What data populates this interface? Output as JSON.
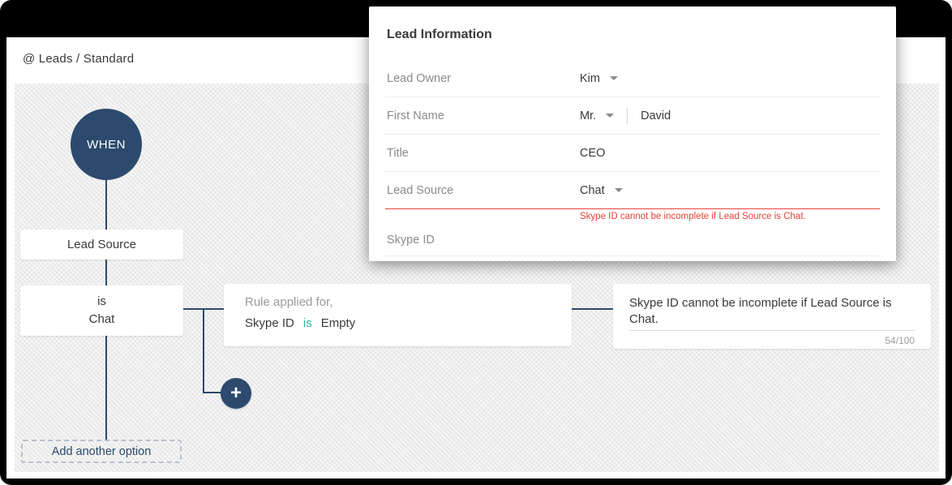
{
  "breadcrumb": {
    "text": "@ Leads  / Standard"
  },
  "flow": {
    "when_label": "WHEN",
    "field_node": "Lead Source",
    "condition_node": {
      "operator": "is",
      "value": "Chat"
    },
    "rule_node": {
      "header": "Rule applied for,",
      "field": "Skype ID",
      "operator": "is",
      "value": "Empty"
    },
    "message_node": {
      "text": "Skype ID cannot be incomplete if Lead Source is Chat.",
      "char_count": "54/100"
    },
    "plus_icon": "+",
    "add_option_label": "Add another option"
  },
  "modal": {
    "title": "Lead Information",
    "fields": {
      "lead_owner": {
        "label": "Lead Owner",
        "value": "Kim"
      },
      "first_name": {
        "label": "First Name",
        "salutation": "Mr.",
        "value": "David"
      },
      "job_title": {
        "label": "Title",
        "value": "CEO"
      },
      "lead_source": {
        "label": "Lead Source",
        "value": "Chat",
        "error": "Skype ID cannot be incomplete if Lead Source is Chat."
      },
      "skype_id": {
        "label": "Skype ID",
        "value": ""
      }
    }
  },
  "colors": {
    "navy": "#2c4a6d",
    "teal_operator": "#2ab3a3",
    "error_red": "#e8423a",
    "canvas_gray": "#ececec"
  }
}
